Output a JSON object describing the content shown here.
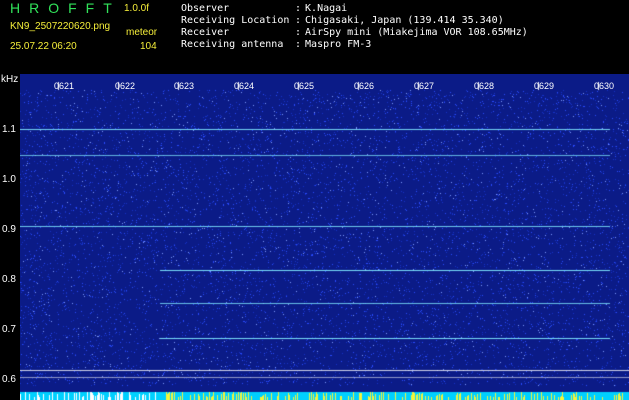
{
  "header": {
    "logo": "HROFFT",
    "version": "1.0.0f",
    "filename": "KN9_2507220620.png",
    "station": "meteor",
    "datetime": "25.07.22 06:20",
    "count": "104",
    "fields": [
      {
        "label": "Observer",
        "value": "K.Nagai"
      },
      {
        "label": "Receiving Location",
        "value": "Chigasaki, Japan (139.414 35.340)"
      },
      {
        "label": "Receiver",
        "value": "AirSpy mini (Miakejima VOR 108.65MHz)"
      },
      {
        "label": "Receiving antenna",
        "value": "Maspro FM-3"
      }
    ]
  },
  "plot": {
    "unit": "kHz",
    "y_ticks": [
      "1.1",
      "1.0",
      "0.9",
      "0.8",
      "0.7",
      "0.6"
    ],
    "x_ticks": [
      "0621",
      "0622",
      "0623",
      "0624",
      "0625",
      "0626",
      "0627",
      "0628",
      "0629",
      "0630"
    ],
    "colors": {
      "background": "#0b1b87",
      "noise": "#2a4bff",
      "line": "#7fe9ff",
      "band": "#00d0ff",
      "marker": "#f4f43a"
    }
  }
}
